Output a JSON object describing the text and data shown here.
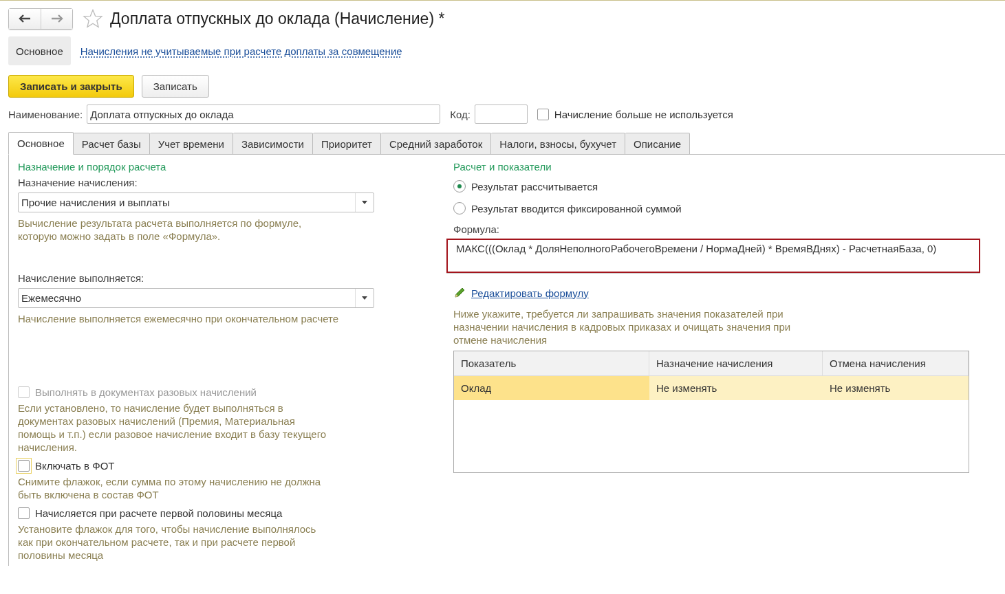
{
  "window": {
    "title": "Доплата отпускных до оклада (Начисление) *",
    "favorite": false
  },
  "sections": [
    {
      "label": "Основное",
      "selected": true
    },
    {
      "label": "Начисления не учитываемые при расчете доплаты за совмещение",
      "selected": false
    }
  ],
  "buttons": [
    {
      "label": "Записать и закрыть",
      "kind": "primary"
    },
    {
      "label": "Записать",
      "kind": "default"
    }
  ],
  "name_field": {
    "label": "Наименование:",
    "value": "Доплата отпускных до оклада"
  },
  "code_field": {
    "label": "Код:"
  },
  "unused": {
    "label": "Начисление больше не используется",
    "checked": false
  },
  "tabs": [
    {
      "label": "Основное",
      "selected": true
    },
    {
      "label": "Расчет базы",
      "selected": false
    },
    {
      "label": "Учет времени",
      "selected": false
    },
    {
      "label": "Зависимости",
      "selected": false
    },
    {
      "label": "Приоритет",
      "selected": false
    },
    {
      "label": "Средний заработок",
      "selected": false
    },
    {
      "label": "Налоги, взносы, бухучет",
      "selected": false
    },
    {
      "label": "Описание",
      "selected": false
    }
  ],
  "left": {
    "title": "Назначение и порядок расчета",
    "selects": [
      {
        "label": "Назначение начисления:",
        "value": "Прочие начисления и выплаты",
        "hint": "Вычисление результата расчета выполняется по формуле, которую можно задать в поле «Формула»."
      },
      {
        "label": "Начисление выполняется:",
        "value": "Ежемесячно",
        "hint": "Начисление выполняется ежемесячно при окончательном расчете"
      }
    ],
    "checkboxes": [
      {
        "label": "Выполнять в документах разовых начислений",
        "checked": false,
        "disabled": true,
        "focused": false,
        "hint": "Если установлено, то начисление будет выполняться в документах разовых начислений (Премия, Материальная помощь и т.п.) если разовое начисление входит в базу текущего начисления."
      },
      {
        "label": "Включать в ФОТ",
        "checked": false,
        "disabled": false,
        "focused": true,
        "hint": "Снимите флажок, если сумма по этому начислению не должна быть включена в состав ФОТ"
      },
      {
        "label": "Начисляется при расчете первой половины месяца",
        "checked": false,
        "disabled": false,
        "focused": false,
        "hint": "Установите флажок для того, чтобы начисление выполнялось как при окончательном расчете, так и при расчете первой половины месяца"
      }
    ]
  },
  "right": {
    "title": "Расчет и показатели",
    "radios": [
      {
        "label": "Результат рассчитывается",
        "selected": true
      },
      {
        "label": "Результат вводится фиксированной суммой",
        "selected": false
      }
    ],
    "formula": {
      "label": "Формула:",
      "value": "МАКС(((Оклад * ДоляНеполногоРабочегоВремени / НормаДней) * ВремяВДнях) - РасчетнаяБаза, 0)",
      "highlighted": true
    },
    "edit_link": "Редактировать формулу",
    "note": "Ниже укажите, требуется ли запрашивать значения показателей при назначении начисления в кадровых приказах и очищать значения при отмене начисления",
    "table": {
      "columns": [
        "Показатель",
        "Назначение начисления",
        "Отмена начисления"
      ],
      "rows": [
        {
          "cells": [
            "Оклад",
            "Не изменять",
            "Не изменять"
          ],
          "selected": true
        }
      ]
    }
  }
}
